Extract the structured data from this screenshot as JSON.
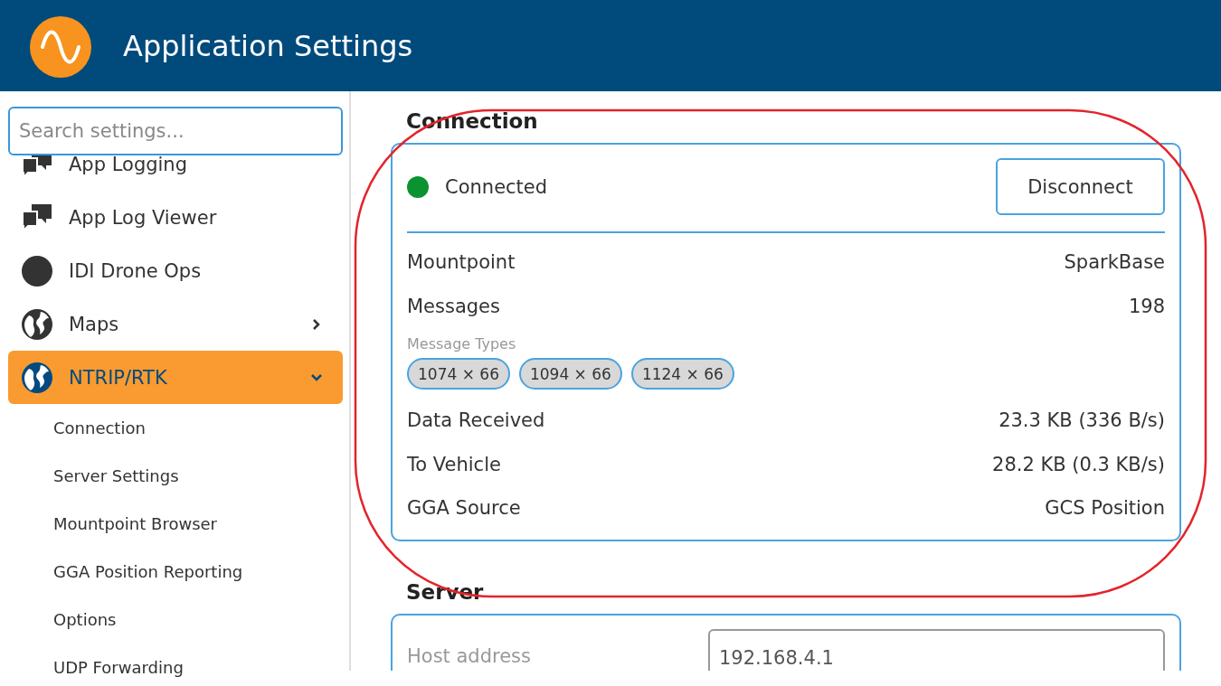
{
  "header": {
    "title": "Application Settings"
  },
  "search": {
    "placeholder": "Search settings..."
  },
  "sidebar": {
    "items": [
      {
        "label": "App Logging",
        "kind": "chat",
        "selected": false
      },
      {
        "label": "App Log Viewer",
        "kind": "chat",
        "selected": false
      },
      {
        "label": "IDI Drone Ops",
        "kind": "circle",
        "selected": false
      },
      {
        "label": "Maps",
        "kind": "globe",
        "selected": false,
        "expanded": false
      },
      {
        "label": "NTRIP/RTK",
        "kind": "globe",
        "selected": true,
        "expanded": true,
        "children": [
          {
            "label": "Connection",
            "selected": false
          },
          {
            "label": "Server Settings",
            "selected": false
          },
          {
            "label": "Mountpoint Browser",
            "selected": false
          },
          {
            "label": "GGA Position Reporting",
            "selected": false
          },
          {
            "label": "Options",
            "selected": false
          },
          {
            "label": "UDP Forwarding",
            "selected": false
          }
        ]
      }
    ]
  },
  "connection": {
    "title": "Connection",
    "status": {
      "label": "Connected",
      "color": "#0b9331"
    },
    "button": "Disconnect",
    "rows": [
      {
        "label": "Mountpoint",
        "value": "SparkBase"
      },
      {
        "label": "Messages",
        "value": "198"
      }
    ],
    "message_types": {
      "label": "Message Types",
      "chips": [
        "1074 × 66",
        "1094 × 66",
        "1124 × 66"
      ]
    },
    "rows_after": [
      {
        "label": "Data Received",
        "value": "23.3 KB (336 B/s)"
      },
      {
        "label": "To Vehicle",
        "value": "28.2 KB (0.3 KB/s)"
      },
      {
        "label": "GGA Source",
        "value": "GCS Position"
      }
    ]
  },
  "server": {
    "title": "Server",
    "fields": [
      {
        "label": "Host address",
        "value": "192.168.4.1"
      }
    ]
  },
  "annotation": {
    "kind": "ellipse",
    "color": "#e3242b"
  }
}
